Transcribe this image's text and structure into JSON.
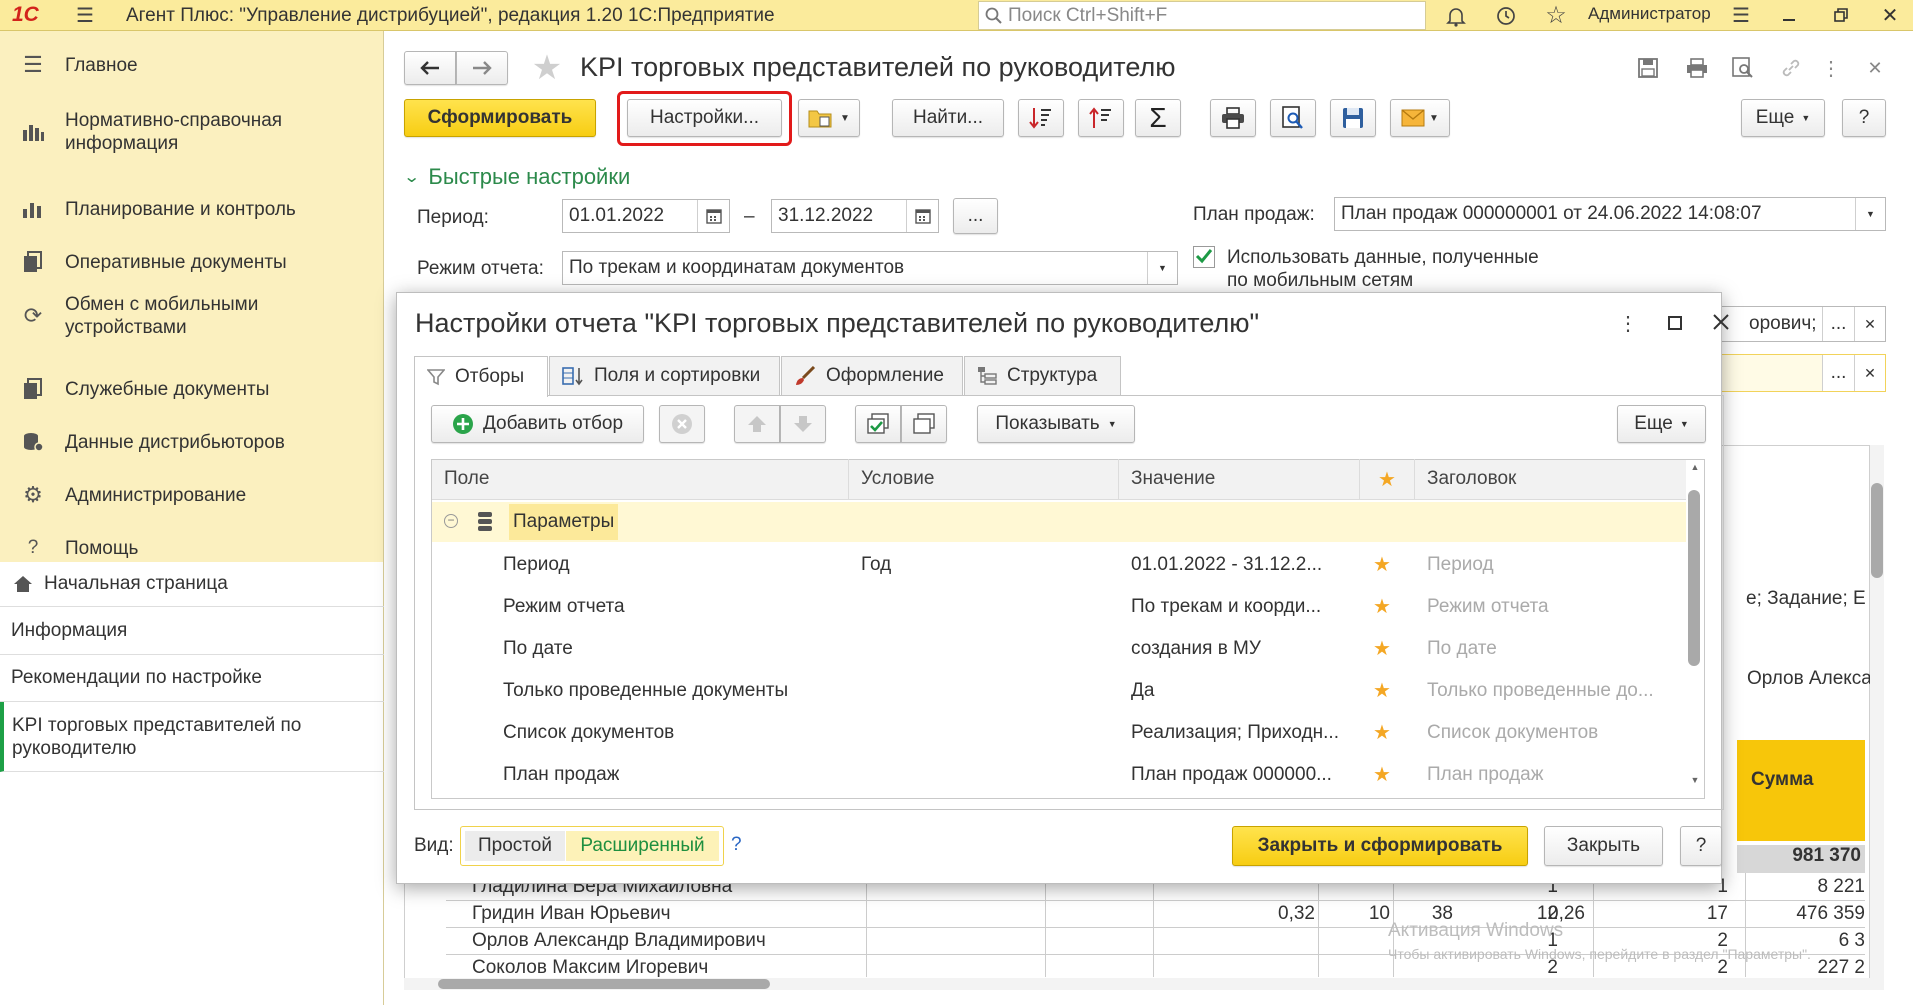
{
  "app": {
    "logo": "1С",
    "title": "Агент Плюс: \"Управление дистрибуцией\", редакция 1.20 1С:Предприятие",
    "search_placeholder": "Поиск Ctrl+Shift+F",
    "user": "Администратор",
    "accent_color": "#fbeb9c"
  },
  "sidebar": {
    "items": [
      {
        "label": "Главное",
        "icon": "menu-lines-icon"
      },
      {
        "label": "Нормативно-справочная информация",
        "icon": "bars-chart-icon"
      },
      {
        "label": "Планирование и контроль",
        "icon": "chart-icon"
      },
      {
        "label": "Оперативные документы",
        "icon": "documents-icon"
      },
      {
        "label": "Обмен с мобильными устройствами",
        "icon": "sync-icon"
      },
      {
        "label": "Служебные документы",
        "icon": "service-docs-icon"
      },
      {
        "label": "Данные дистрибьюторов",
        "icon": "database-icon"
      },
      {
        "label": "Администрирование",
        "icon": "gear-icon"
      },
      {
        "label": "Помощь",
        "icon": "question-icon"
      }
    ],
    "pages": [
      {
        "label": "Начальная страница",
        "icon": "home-icon"
      },
      {
        "label": "Информация"
      },
      {
        "label": "Рекомендации по настройке"
      },
      {
        "label": "KPI торговых представителей по руководителю"
      }
    ]
  },
  "form": {
    "title": "KPI торговых представителей по руководителю",
    "generate_button": "Сформировать",
    "settings_button": "Настройки...",
    "find_button": "Найти...",
    "more_button": "Еще",
    "help_button": "?",
    "quick_settings": "Быстрые настройки",
    "period_label": "Период:",
    "period_from": "01.01.2022",
    "period_dash": "–",
    "period_to": "31.12.2022",
    "ellipsis": "...",
    "mode_label": "Режим отчета:",
    "mode_value": "По трекам и координатам документов",
    "plan_label": "План продаж:",
    "plan_value": "План продаж 000000001 от 24.06.2022 14:08:07",
    "use_mobile_label": "Использовать данные, полученные по мобильным сетям",
    "use_mobile_checked": true,
    "partial_field_1": "орович;",
    "partial_text_1": "е; Задание; Е",
    "partial_text_2": "Орлов Алекса",
    "sum_header": "Сумма",
    "total_value": "981 370",
    "watermark_line1": "Активация Windows",
    "watermark_line2": "Чтобы активировать Windows, перейдите в раздел \"Параметры\"."
  },
  "report_rows": [
    {
      "name": "Гладилина Вера Михайловна",
      "c1": "",
      "c2": "1",
      "c3": "",
      "c4": "",
      "c5": "",
      "c6": "1",
      "sum": "8 221"
    },
    {
      "name": "Гридин Иван Юрьевич",
      "c1": "38",
      "c2": "12",
      "c3": "0,32",
      "c4": "10",
      "c5": "0,26",
      "c6": "17",
      "sum": "476 359"
    },
    {
      "name": "Орлов Александр Владимирович",
      "c1": "",
      "c2": "1",
      "c3": "",
      "c4": "",
      "c5": "",
      "c6": "2",
      "sum": "6 3"
    },
    {
      "name": "Соколов Максим Игоревич",
      "c1": "",
      "c2": "2",
      "c3": "",
      "c4": "",
      "c5": "",
      "c6": "2",
      "sum": "227 2"
    }
  ],
  "dialog": {
    "title": "Настройки отчета \"KPI торговых представителей по руководителю\"",
    "tabs": [
      "Отборы",
      "Поля и сортировки",
      "Оформление",
      "Структура"
    ],
    "add_filter": "Добавить отбор",
    "show_button": "Показывать",
    "more_button": "Еще",
    "columns": [
      "Поле",
      "Условие",
      "Значение",
      "Заголовок"
    ],
    "group_label": "Параметры",
    "rows": [
      {
        "field": "Период",
        "condition": "Год",
        "value": "01.01.2022 - 31.12.2...",
        "title": "Период"
      },
      {
        "field": "Режим отчета",
        "condition": "",
        "value": "По трекам и коорди...",
        "title": "Режим отчета"
      },
      {
        "field": "По дате",
        "condition": "",
        "value": "создания в МУ",
        "title": "По дате"
      },
      {
        "field": "Только проведенные документы",
        "condition": "",
        "value": "Да",
        "title": "Только проведенные до..."
      },
      {
        "field": "Список документов",
        "condition": "",
        "value": "Реализация; Приходн...",
        "title": "Список документов"
      },
      {
        "field": "План продаж",
        "condition": "",
        "value": "План продаж 000000...",
        "title": "План продаж"
      }
    ],
    "view_label": "Вид:",
    "view_simple": "Простой",
    "view_extended": "Расширенный",
    "help_link": "?",
    "close_generate": "Закрыть и сформировать",
    "close": "Закрыть",
    "help_button": "?"
  }
}
